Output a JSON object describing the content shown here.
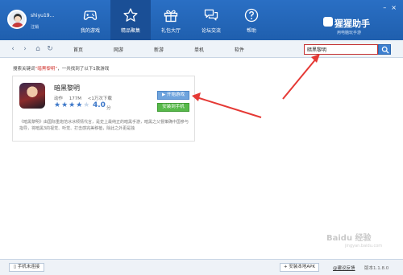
{
  "user": {
    "name": "shiyu19...",
    "logout": "注销"
  },
  "nav": [
    {
      "label": "我的游戏",
      "icon": "gamepad-icon"
    },
    {
      "label": "精品聚集",
      "icon": "star-icon"
    },
    {
      "label": "礼包大厅",
      "icon": "gift-icon"
    },
    {
      "label": "论坛交流",
      "icon": "chat-icon"
    },
    {
      "label": "帮助",
      "icon": "help-icon"
    }
  ],
  "brand": {
    "name": "猩猩助手",
    "slogan": "用电脑玩手游"
  },
  "window": {
    "min": "–",
    "close": "×"
  },
  "categories": [
    "首页",
    "网游",
    "新游",
    "单机",
    "软件"
  ],
  "search": {
    "value": "暗黑黎明"
  },
  "results": {
    "prefix": "搜索关键词",
    "keyword": "“暗黑黎明”",
    "suffix": "，一共找到了以下1款游戏"
  },
  "app": {
    "name": "暗黑黎明",
    "genre": "动作",
    "size": "177M",
    "downloads": "<1万次下载",
    "rating": 4.0,
    "rating_display": "4.0",
    "rating_unit": "分",
    "start_label": "▶ 开始游戏",
    "install_label": "安装到手机",
    "description": "《暗黑黎明》由国际重炮范冰冰倾情代言，是史上最纯正的暗黑手游，暗黑之父督策确中国参与指导，将暗黑3的视觉、听觉、打击感完美移植，除此之外更是独"
  },
  "status": {
    "phone": "手机未连接",
    "apk": "+ 安装本地APK",
    "feedback": "@建议反馈",
    "version": "版本1.1.8.0"
  },
  "watermark": {
    "text": "Baidu 经验",
    "sub": "jingyan.baidu.com"
  },
  "colors": {
    "header": "#2a6fc4",
    "accent": "#3d78c9",
    "arrow": "#e53935",
    "install": "#57b94a"
  }
}
